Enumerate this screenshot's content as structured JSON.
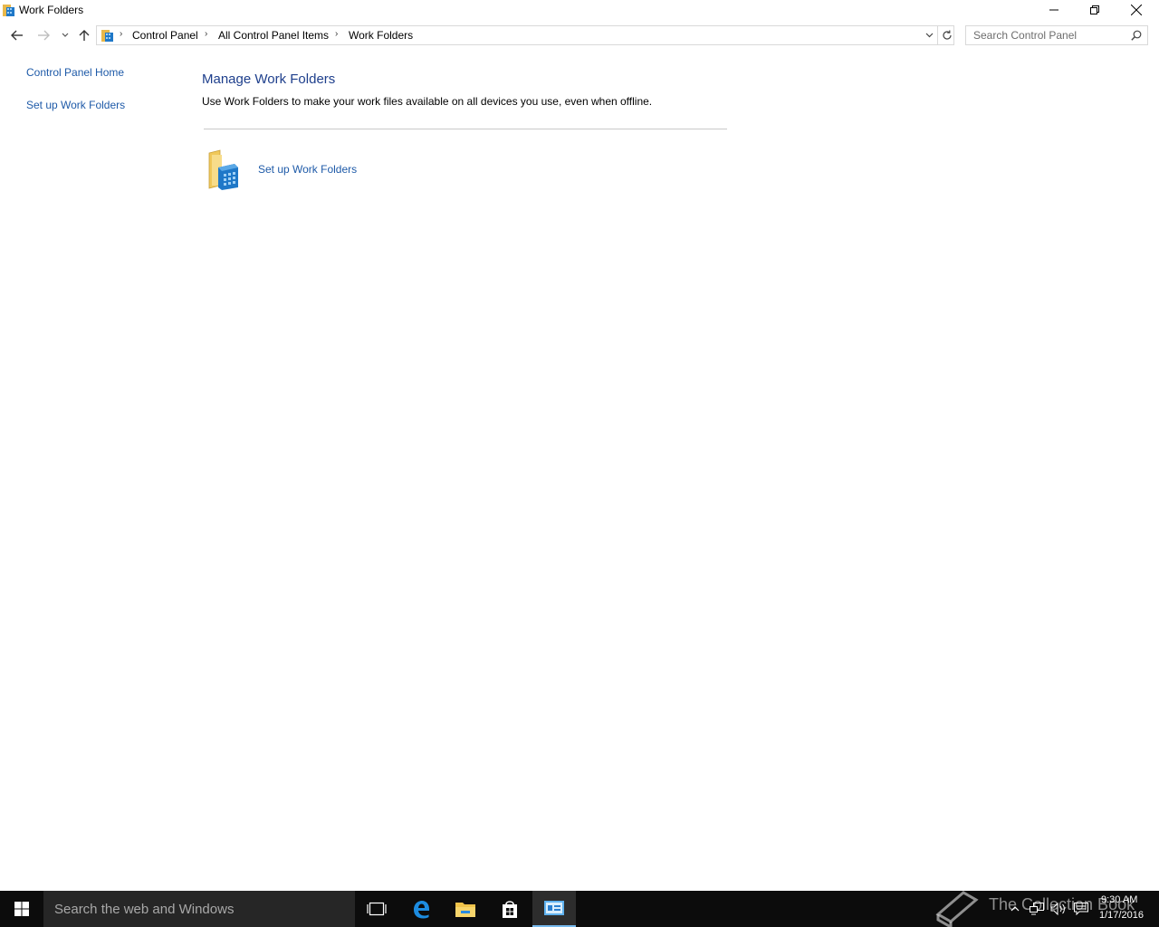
{
  "window": {
    "title": "Work Folders",
    "minimize_icon": "minimize-icon",
    "restore_icon": "restore-icon",
    "close_icon": "close-icon"
  },
  "navigation": {
    "back_icon": "back-arrow-icon",
    "forward_icon": "forward-arrow-icon",
    "recent_icon": "chevron-down-icon",
    "up_icon": "up-arrow-icon"
  },
  "address_bar": {
    "breadcrumbs": [
      "Control Panel",
      "All Control Panel Items",
      "Work Folders"
    ]
  },
  "search": {
    "placeholder": "Search Control Panel"
  },
  "left_pane": {
    "links": [
      "Control Panel Home",
      "Set up Work Folders"
    ]
  },
  "main": {
    "heading": "Manage Work Folders",
    "description": "Use Work Folders to make your work files available on all devices you use, even when offline.",
    "task_link": "Set up Work Folders"
  },
  "taskbar": {
    "search_placeholder": "Search the web and Windows",
    "apps": [
      "task-view-icon",
      "edge-icon",
      "file-explorer-icon",
      "store-icon",
      "control-panel-icon"
    ],
    "watermark": "The Collection Book",
    "clock": {
      "time": "9:30 AM",
      "date": "1/17/2016"
    }
  },
  "colors": {
    "link": "#1e5aa8",
    "heading": "#1e3f8c",
    "taskbar": "#0c0c0c",
    "taskbar_search": "#262626",
    "active_underline": "#76b9ed"
  }
}
